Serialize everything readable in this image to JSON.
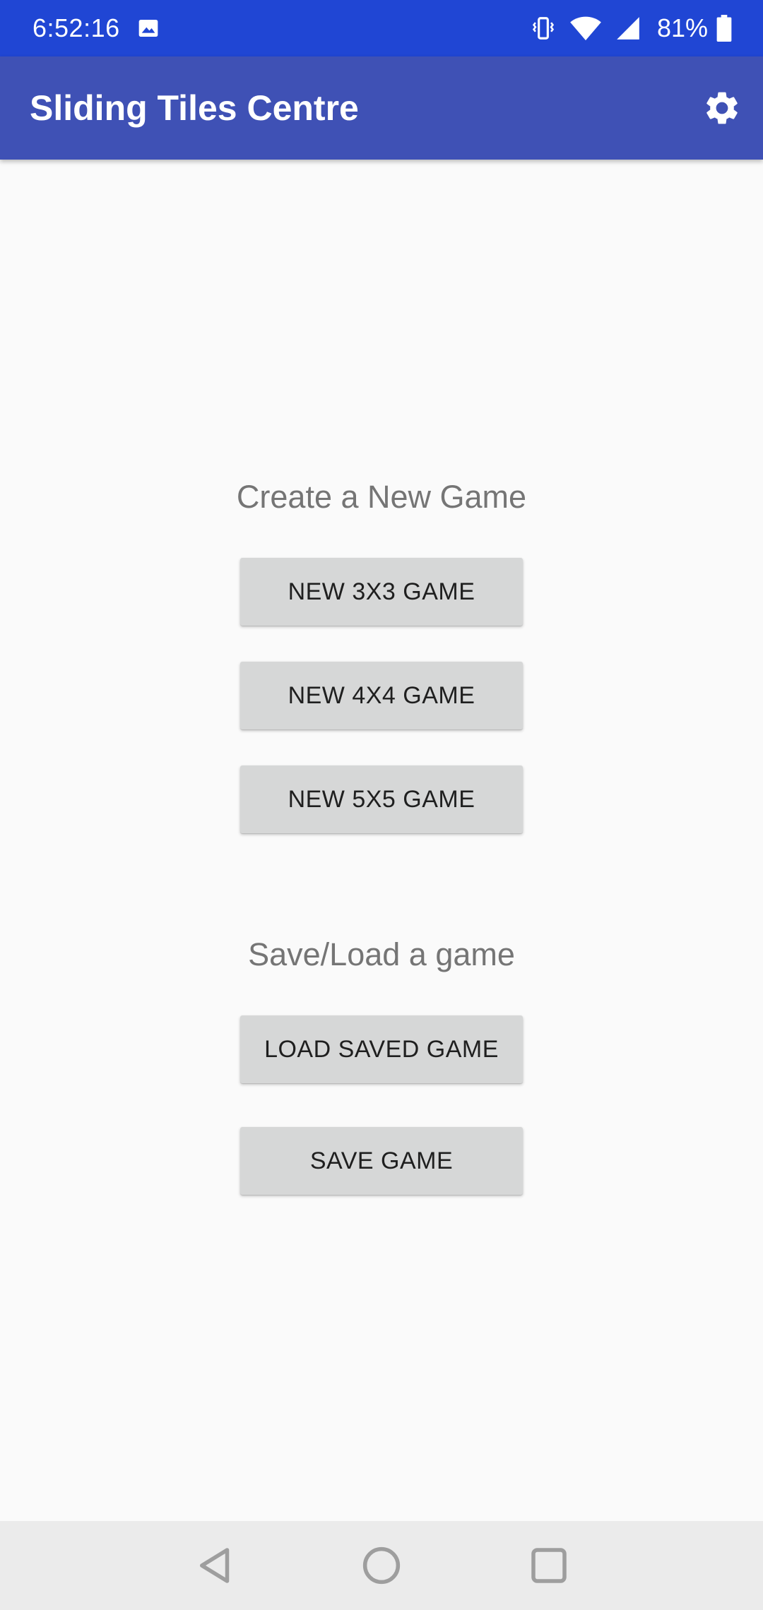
{
  "status_bar": {
    "time": "6:52:16",
    "battery_percent": "81%",
    "icons": [
      "image-icon",
      "vibrate-icon",
      "wifi-icon",
      "signal-icon",
      "battery-icon"
    ]
  },
  "app_bar": {
    "title": "Sliding Tiles Centre",
    "action_icon": "settings-icon"
  },
  "new_game_section": {
    "label": "Create a New Game",
    "buttons": [
      "NEW 3X3 GAME",
      "NEW 4X4 GAME",
      "NEW 5X5 GAME"
    ]
  },
  "save_load_section": {
    "label": "Save/Load a game",
    "buttons": [
      "LOAD SAVED GAME",
      "SAVE GAME"
    ]
  },
  "nav_bar": {
    "icons": [
      "back-icon",
      "home-icon",
      "recents-icon"
    ]
  },
  "colors": {
    "status_bar": "#2046d4",
    "app_bar": "#3f51b5",
    "background": "#fafafa",
    "button": "#d6d7d7",
    "section_label": "#757575",
    "nav_bar": "#ebebeb"
  }
}
